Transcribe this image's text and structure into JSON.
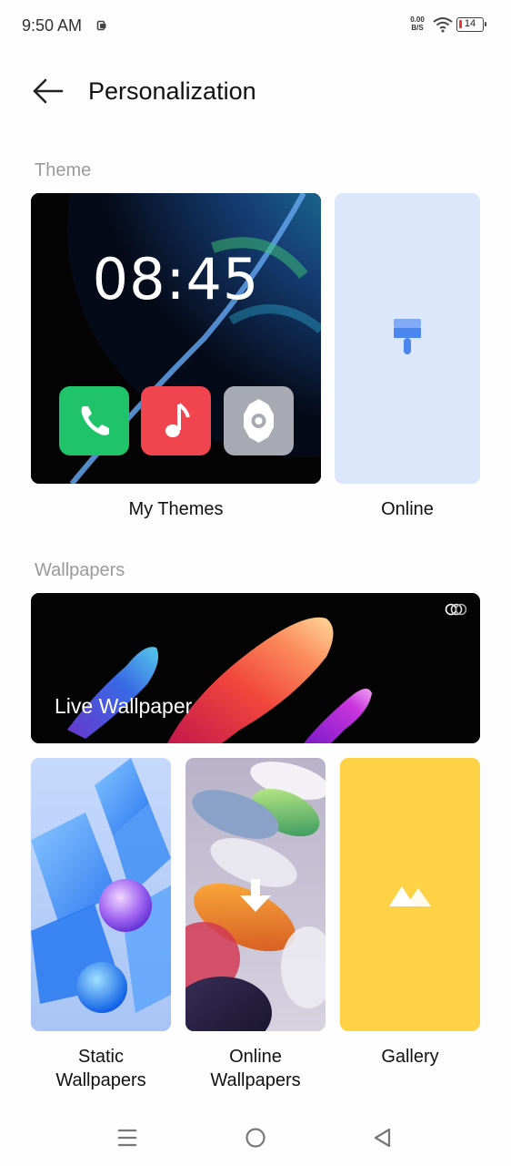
{
  "status_bar": {
    "time": "9:50 AM",
    "net_speed_value": "0.00",
    "net_speed_unit": "B/S",
    "battery": "14"
  },
  "header": {
    "title": "Personalization"
  },
  "theme_section": {
    "label": "Theme",
    "my_themes": {
      "clock": "08:45",
      "caption": "My Themes"
    },
    "online": {
      "caption": "Online"
    }
  },
  "wallpapers_section": {
    "label": "Wallpapers",
    "live": {
      "label": "Live Wallpaper"
    },
    "static": {
      "caption_line1": "Static",
      "caption_line2": "Wallpapers"
    },
    "online": {
      "caption_line1": "Online",
      "caption_line2": "Wallpapers"
    },
    "gallery": {
      "caption": "Gallery"
    }
  },
  "colors": {
    "theme_online_bg": "#dce7fb",
    "gallery_bg": "#fed246",
    "phone_green": "#1fc46a",
    "music_red": "#f0454f",
    "settings_gray": "#a7aab2"
  },
  "icons": {
    "back": "arrow-left-icon",
    "paint": "paint-brush-icon",
    "live_toggle": "live-indicator-icon",
    "download": "download-arrow-icon",
    "gallery": "mountain-image-icon",
    "nav_menu": "menu-lines-icon",
    "nav_home": "home-circle-icon",
    "nav_back": "back-triangle-icon"
  }
}
